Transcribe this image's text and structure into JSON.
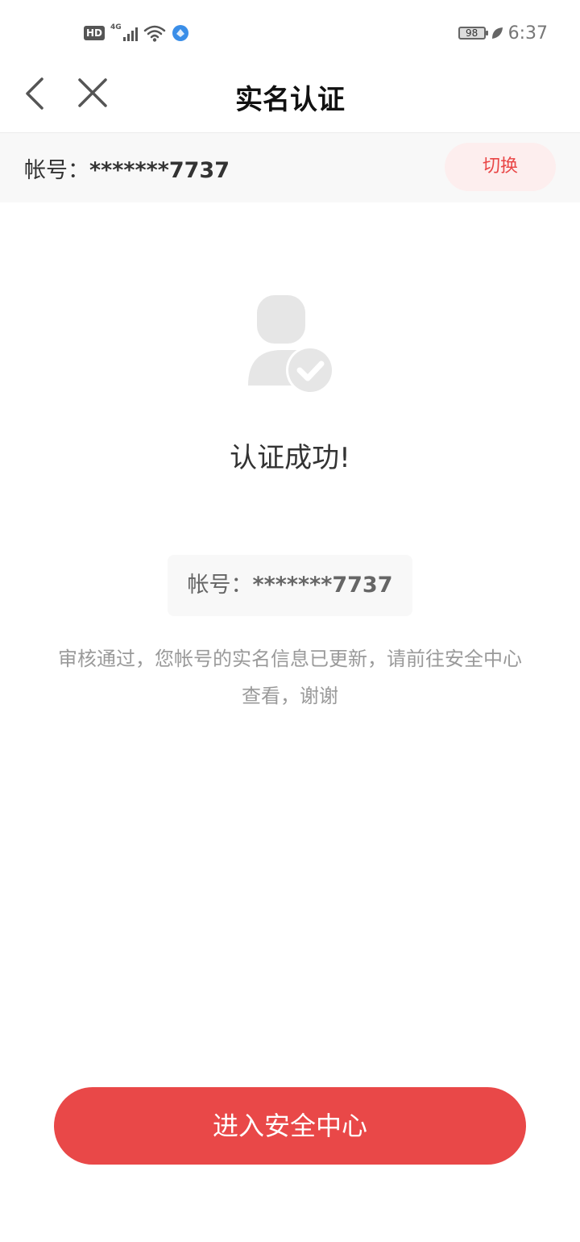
{
  "status_bar": {
    "hd_label": "HD",
    "network_label": "4G",
    "battery": "98",
    "time": "6:37"
  },
  "navbar": {
    "title": "实名认证",
    "back_icon": "chevron-left-icon",
    "close_icon": "close-icon"
  },
  "account_bar": {
    "label": "帐号：",
    "masked_account": "*******7737",
    "switch_label": "切换"
  },
  "result": {
    "icon": "user-verified-icon",
    "title": "认证成功!",
    "account_label": "帐号：",
    "account_value": "*******7737",
    "description": "审核通过，您帐号的实名信息已更新，请前往安全中心查看，谢谢"
  },
  "action": {
    "button_label": "进入安全中心"
  },
  "colors": {
    "accent": "#e94848",
    "switch_bg": "#fdeeee",
    "icon_gray": "#e6e6e6"
  }
}
